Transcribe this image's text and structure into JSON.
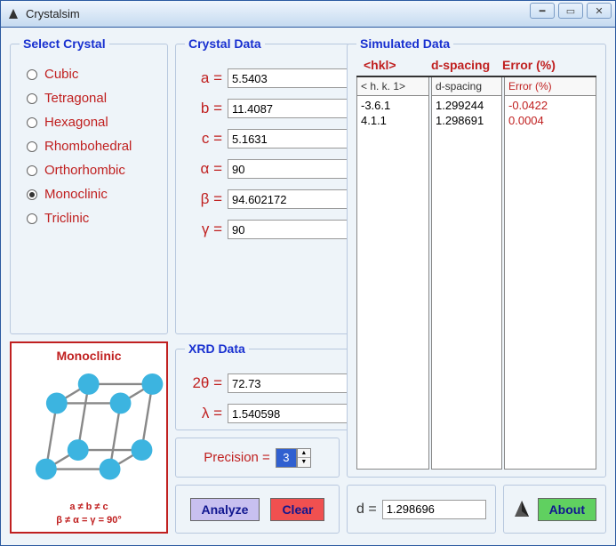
{
  "window": {
    "title": "Crystalsim"
  },
  "crystal_systems": [
    {
      "label": "Cubic",
      "selected": false
    },
    {
      "label": "Tetragonal",
      "selected": false
    },
    {
      "label": "Hexagonal",
      "selected": false
    },
    {
      "label": "Rhombohedral",
      "selected": false
    },
    {
      "label": "Orthorhombic",
      "selected": false
    },
    {
      "label": "Monoclinic",
      "selected": true
    },
    {
      "label": "Triclinic",
      "selected": false
    }
  ],
  "legends": {
    "select": "Select Crystal",
    "crystal_data": "Crystal Data",
    "xrd": "XRD Data",
    "sim": "Simulated Data"
  },
  "crystal_data": {
    "a_label": "a =",
    "a": "5.5403",
    "b_label": "b =",
    "b": "11.4087",
    "c_label": "c =",
    "c": "5.1631",
    "alpha_label": "α =",
    "alpha": "90",
    "beta_label": "β =",
    "beta": "94.602172",
    "gamma_label": "γ =",
    "gamma": "90"
  },
  "xrd": {
    "twotheta_label": "2θ =",
    "twotheta": "72.73",
    "lambda_label": "λ =",
    "lambda": "1.540598"
  },
  "precision": {
    "label": "Precision =",
    "value": "3"
  },
  "buttons": {
    "analyze": "Analyze",
    "clear": "Clear",
    "about": "About"
  },
  "sim": {
    "headers": {
      "hkl": "<hkl>",
      "dspacing": "d-spacing",
      "error": "Error (%)"
    },
    "col_heads": {
      "hkl": "< h. k. 1>",
      "dspacing": "d-spacing",
      "error": "Error (%)"
    },
    "rows": [
      {
        "hkl": "-3.6.1",
        "d": "1.299244",
        "err": "-0.0422"
      },
      {
        "hkl": "4.1.1",
        "d": "1.298691",
        "err": "0.0004"
      }
    ]
  },
  "d_result": {
    "label": "d =",
    "value": "1.298696"
  },
  "diagram": {
    "name": "Monoclinic",
    "formula1": "a ≠ b ≠ c",
    "formula2": "β ≠ α = γ = 90°"
  }
}
